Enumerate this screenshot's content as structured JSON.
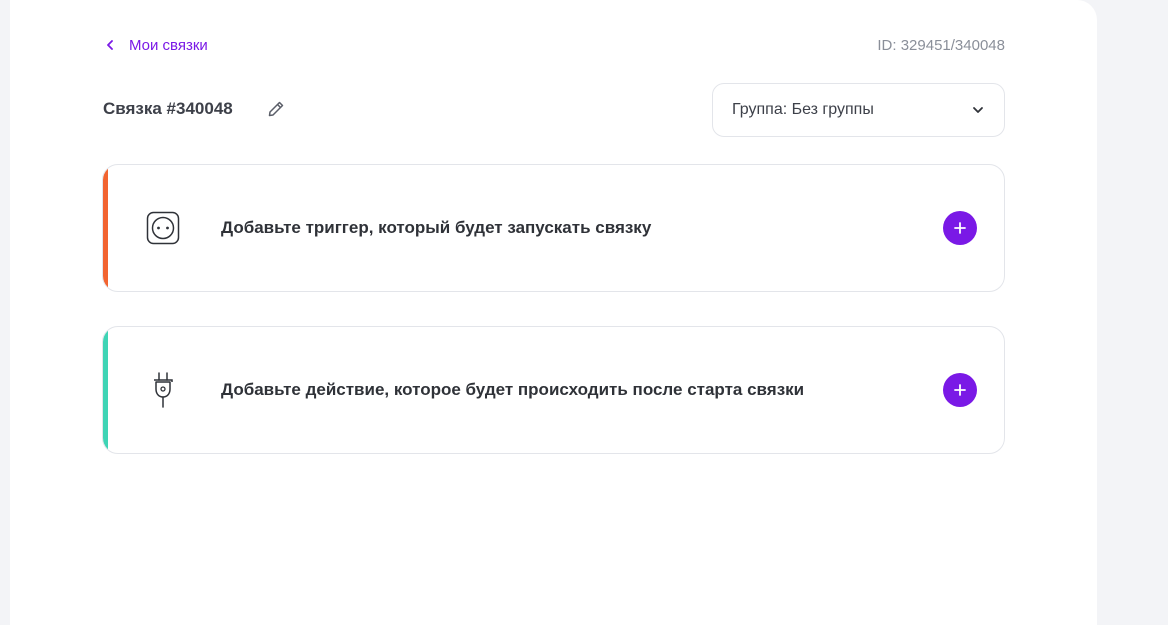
{
  "nav": {
    "back_label": "Мои связки",
    "id_label": "ID: 329451/340048"
  },
  "header": {
    "title": "Связка #340048",
    "edit_icon": "pencil-icon"
  },
  "group_select": {
    "value": "Группа: Без группы",
    "icon": "chevron-down-icon"
  },
  "steps": [
    {
      "kind": "trigger",
      "text": "Добавьте триггер, который будет запускать связку",
      "icon": "socket-icon",
      "accent": "#f26430"
    },
    {
      "kind": "action",
      "text": "Добавьте действие, которое будет происходить после старта связки",
      "icon": "plug-icon",
      "accent": "#3fd4b5"
    }
  ],
  "colors": {
    "primary": "#7a19e6",
    "text": "#3d4049",
    "muted": "#8a8f99"
  }
}
